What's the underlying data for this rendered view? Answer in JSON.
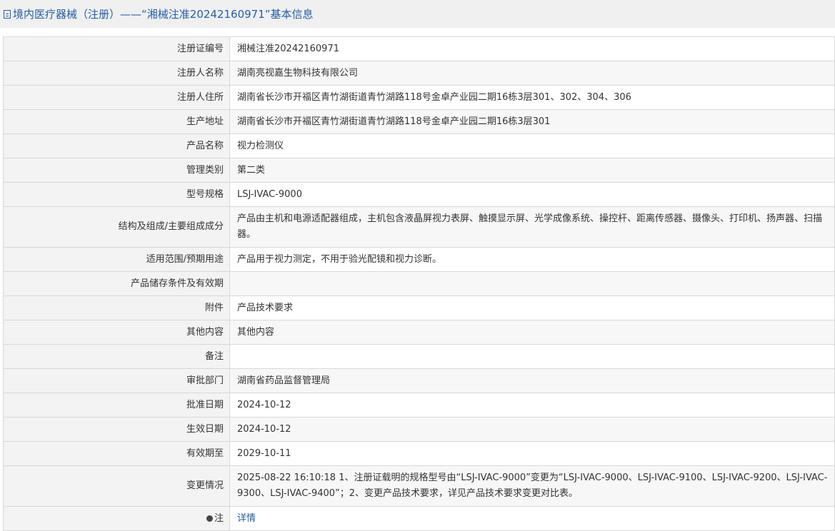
{
  "header": {
    "title": "境内医疗器械（注册）——“湘械注准20242160971”基本信息"
  },
  "rows": [
    {
      "label": "注册证编号",
      "value": "湘械注准20242160971"
    },
    {
      "label": "注册人名称",
      "value": "湖南亮视嘉生物科技有限公司"
    },
    {
      "label": "注册人住所",
      "value": "湖南省长沙市开福区青竹湖街道青竹湖路118号金卓产业园二期16栋3层301、302、304、306"
    },
    {
      "label": "生产地址",
      "value": "湖南省长沙市开福区青竹湖街道青竹湖路118号金卓产业园二期16栋3层301"
    },
    {
      "label": "产品名称",
      "value": "视力检测仪"
    },
    {
      "label": "管理类别",
      "value": "第二类"
    },
    {
      "label": "型号规格",
      "value": "LSJ-IVAC-9000"
    },
    {
      "label": "结构及组成/主要组成成分",
      "value": "产品由主机和电源适配器组成，主机包含液晶屏视力表屏、触摸显示屏、光学成像系统、操控杆、距离传感器、摄像头、打印机、扬声器、扫描器。"
    },
    {
      "label": "适用范围/预期用途",
      "value": "产品用于视力测定，不用于验光配镜和视力诊断。"
    },
    {
      "label": "产品储存条件及有效期",
      "value": ""
    },
    {
      "label": "附件",
      "value": "产品技术要求"
    },
    {
      "label": "其他内容",
      "value": "其他内容"
    },
    {
      "label": "备注",
      "value": ""
    },
    {
      "label": "审批部门",
      "value": "湖南省药品监督管理局"
    },
    {
      "label": "批准日期",
      "value": "2024-10-12"
    },
    {
      "label": "生效日期",
      "value": "2024-10-12"
    },
    {
      "label": "有效期至",
      "value": "2029-10-11"
    },
    {
      "label": "变更情况",
      "value": "2025-08-22 16:10:18 1、注册证载明的规格型号由“LSJ-IVAC-9000”变更为“LSJ-IVAC-9000、LSJ-IVAC-9100、LSJ-IVAC-9200、LSJ-IVAC-9300、LSJ-IVAC-9400”；2、变更产品技术要求，详见产品技术要求变更对比表。"
    }
  ],
  "note": {
    "label": "注",
    "link": "详情"
  }
}
